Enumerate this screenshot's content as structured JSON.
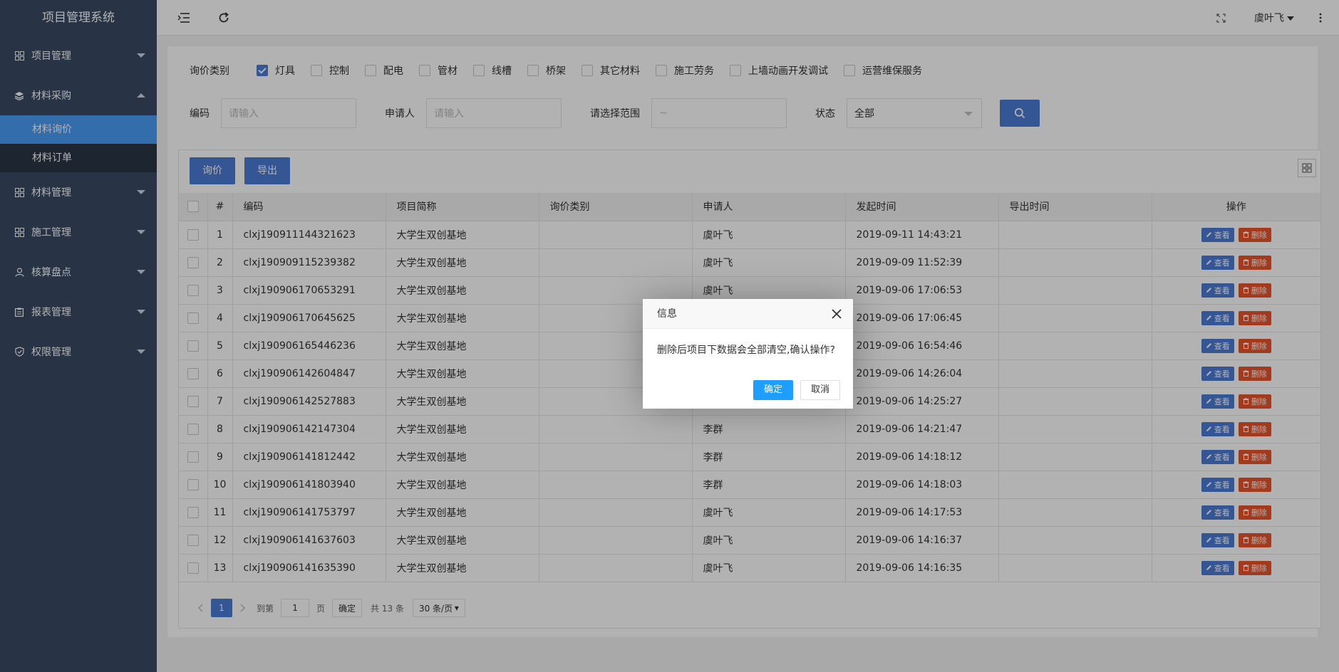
{
  "app": {
    "title": "项目管理系统"
  },
  "sidebar": {
    "items": [
      {
        "label": "项目管理",
        "icon": "grid-icon"
      },
      {
        "label": "材料采购",
        "icon": "layers-icon"
      },
      {
        "label": "材料管理",
        "icon": "grid-icon"
      },
      {
        "label": "施工管理",
        "icon": "grid-icon"
      },
      {
        "label": "核算盘点",
        "icon": "user-icon"
      },
      {
        "label": "报表管理",
        "icon": "clipboard-icon"
      },
      {
        "label": "权限管理",
        "icon": "shield-icon"
      }
    ],
    "sub": [
      {
        "label": "材料询价"
      },
      {
        "label": "材料订单"
      }
    ]
  },
  "topbar": {
    "user": "虞叶飞"
  },
  "filters": {
    "category_label": "询价类别",
    "categories": [
      {
        "label": "灯具",
        "checked": true
      },
      {
        "label": "控制",
        "checked": false
      },
      {
        "label": "配电",
        "checked": false
      },
      {
        "label": "管材",
        "checked": false
      },
      {
        "label": "线槽",
        "checked": false
      },
      {
        "label": "桥架",
        "checked": false
      },
      {
        "label": "其它材料",
        "checked": false
      },
      {
        "label": "施工劳务",
        "checked": false
      },
      {
        "label": "上墙动画开发调试",
        "checked": false
      },
      {
        "label": "运营维保服务",
        "checked": false
      }
    ],
    "code_label": "编码",
    "code_placeholder": "请输入",
    "applicant_label": "申请人",
    "applicant_placeholder": "请输入",
    "range_label": "请选择范围",
    "range_placeholder": "~",
    "status_label": "状态",
    "status_value": "全部"
  },
  "toolbar": {
    "inquiry": "询价",
    "export": "导出"
  },
  "table": {
    "headers": [
      "#",
      "编码",
      "项目简称",
      "询价类别",
      "申请人",
      "发起时间",
      "导出时间",
      "操作"
    ],
    "view_label": "查看",
    "delete_label": "删除",
    "rows": [
      {
        "idx": "1",
        "code": "clxj190911144321623",
        "project": "大学生双创基地",
        "category": "",
        "applicant": "虞叶飞",
        "time": "2019-09-11 14:43:21",
        "export": ""
      },
      {
        "idx": "2",
        "code": "clxj190909115239382",
        "project": "大学生双创基地",
        "category": "",
        "applicant": "虞叶飞",
        "time": "2019-09-09 11:52:39",
        "export": ""
      },
      {
        "idx": "3",
        "code": "clxj190906170653291",
        "project": "大学生双创基地",
        "category": "",
        "applicant": "虞叶飞",
        "time": "2019-09-06 17:06:53",
        "export": ""
      },
      {
        "idx": "4",
        "code": "clxj190906170645625",
        "project": "大学生双创基地",
        "category": "",
        "applicant": "",
        "time": "2019-09-06 17:06:45",
        "export": ""
      },
      {
        "idx": "5",
        "code": "clxj190906165446236",
        "project": "大学生双创基地",
        "category": "",
        "applicant": "",
        "time": "2019-09-06 16:54:46",
        "export": ""
      },
      {
        "idx": "6",
        "code": "clxj190906142604847",
        "project": "大学生双创基地",
        "category": "",
        "applicant": "",
        "time": "2019-09-06 14:26:04",
        "export": ""
      },
      {
        "idx": "7",
        "code": "clxj190906142527883",
        "project": "大学生双创基地",
        "category": "",
        "applicant": "",
        "time": "2019-09-06 14:25:27",
        "export": ""
      },
      {
        "idx": "8",
        "code": "clxj190906142147304",
        "project": "大学生双创基地",
        "category": "",
        "applicant": "李群",
        "time": "2019-09-06 14:21:47",
        "export": ""
      },
      {
        "idx": "9",
        "code": "clxj190906141812442",
        "project": "大学生双创基地",
        "category": "",
        "applicant": "李群",
        "time": "2019-09-06 14:18:12",
        "export": ""
      },
      {
        "idx": "10",
        "code": "clxj190906141803940",
        "project": "大学生双创基地",
        "category": "",
        "applicant": "李群",
        "time": "2019-09-06 14:18:03",
        "export": ""
      },
      {
        "idx": "11",
        "code": "clxj190906141753797",
        "project": "大学生双创基地",
        "category": "",
        "applicant": "虞叶飞",
        "time": "2019-09-06 14:17:53",
        "export": ""
      },
      {
        "idx": "12",
        "code": "clxj190906141637603",
        "project": "大学生双创基地",
        "category": "",
        "applicant": "虞叶飞",
        "time": "2019-09-06 14:16:37",
        "export": ""
      },
      {
        "idx": "13",
        "code": "clxj190906141635390",
        "project": "大学生双创基地",
        "category": "",
        "applicant": "虞叶飞",
        "time": "2019-09-06 14:16:35",
        "export": ""
      }
    ]
  },
  "pager": {
    "current": "1",
    "goto_prefix": "到第",
    "goto_value": "1",
    "goto_suffix": "页",
    "confirm": "确定",
    "total": "共 13 条",
    "per_page": "30 条/页"
  },
  "dialog": {
    "title": "信息",
    "message": "删除后项目下数据会全部清空,确认操作?",
    "ok": "确定",
    "cancel": "取消"
  },
  "colors": {
    "sidebar_bg": "#3a4a64",
    "sidebar_active": "#4b9cf7",
    "primary": "#4b7bd6",
    "danger": "#e8542c",
    "dialog_ok": "#1e9fff"
  }
}
